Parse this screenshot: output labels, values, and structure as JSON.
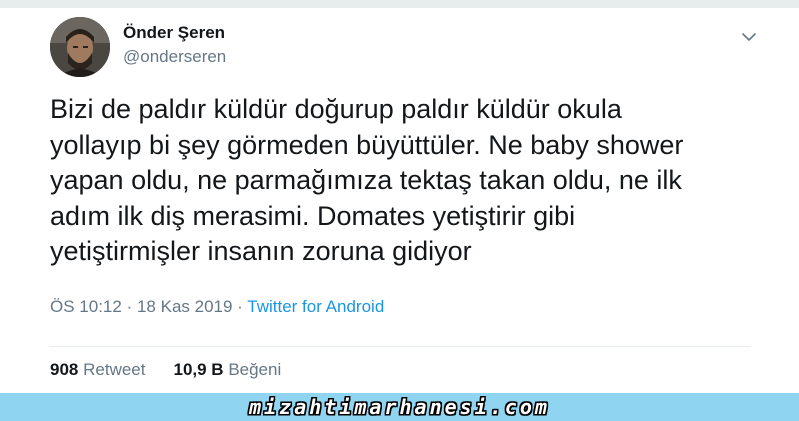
{
  "tweet": {
    "author": {
      "display_name": "Önder Şeren",
      "handle": "@onderseren"
    },
    "text_lines": [
      "Bizi de paldır küldür doğurup paldır küldür okula",
      "yollayıp bi şey görmeden büyüttüler. Ne baby shower",
      "yapan oldu, ne parmağımıza tektaş takan oldu, ne ilk",
      "adım ilk diş merasimi. Domates yetiştirir gibi",
      "yetiştirmişler insanın zoruna gidiyor"
    ],
    "meta": {
      "time": "ÖS 10:12",
      "separator": "·",
      "date": "18 Kas 2019",
      "source": "Twitter for Android"
    },
    "stats": {
      "retweets_count": "908",
      "retweets_label": "Retweet",
      "likes_count": "10,9 B",
      "likes_label": "Beğeni"
    }
  },
  "icons": {
    "menu": "chevron-down-icon"
  },
  "colors": {
    "text": "#14171a",
    "secondary": "#657786",
    "link": "#1b95e0",
    "footer_bg": "#8fd5f2"
  },
  "footer": {
    "watermark": "mizahtimarhanesi.com"
  }
}
